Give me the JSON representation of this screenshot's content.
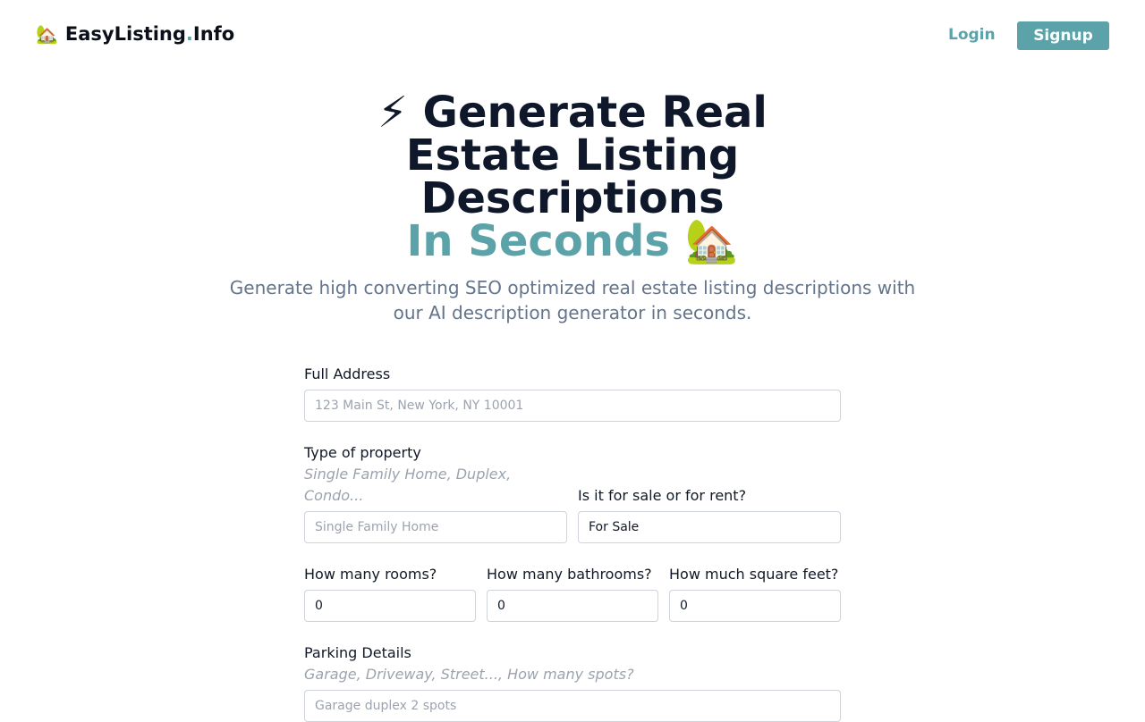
{
  "nav": {
    "brand_icon": "house-with-garden-icon",
    "brand_emoji": "🏡",
    "brand_name": "EasyListing",
    "brand_dot": ".",
    "brand_suffix": "Info",
    "login_label": "Login",
    "signup_label": "Signup",
    "accent_color": "#5ba3a8"
  },
  "hero": {
    "bolt": "⚡",
    "title_main": "Generate Real Estate Listing Descriptions",
    "title_accent": "In Seconds",
    "title_emoji": "🏡",
    "subtitle": "Generate high converting SEO optimized real estate listing descriptions with our AI description generator in seconds."
  },
  "form": {
    "address": {
      "label": "Full Address",
      "placeholder": "123 Main St, New York, NY 10001"
    },
    "property_type": {
      "label": "Type of property",
      "hint": "Single Family Home, Duplex, Condo...",
      "placeholder": "Single Family Home"
    },
    "sale_or_rent": {
      "label": "Is it for sale or for rent?",
      "value": "For Sale"
    },
    "rooms": {
      "label": "How many rooms?",
      "value": "0"
    },
    "bathrooms": {
      "label": "How many bathrooms?",
      "value": "0"
    },
    "square_feet": {
      "label": "How much square feet?",
      "value": "0"
    },
    "parking": {
      "label": "Parking Details",
      "hint": "Garage, Driveway, Street..., How many spots?",
      "placeholder": "Garage duplex 2 spots"
    }
  }
}
